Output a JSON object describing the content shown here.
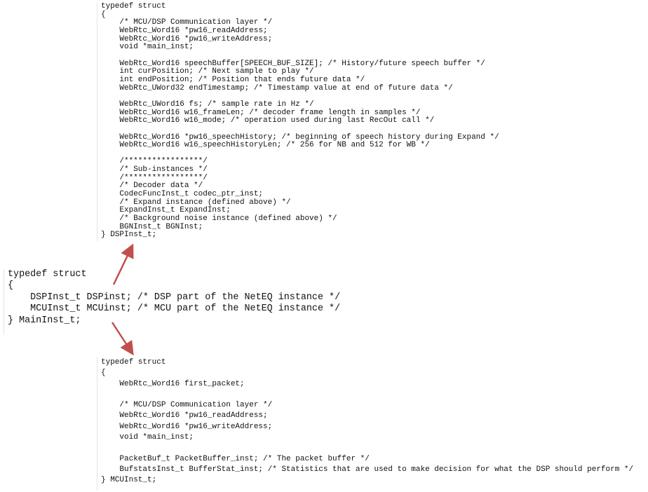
{
  "dsp_struct": {
    "lines": [
      "typedef struct",
      "{",
      "    /* MCU/DSP Communication layer */",
      "    WebRtc_Word16 *pw16_readAddress;",
      "    WebRtc_Word16 *pw16_writeAddress;",
      "    void *main_inst;",
      "",
      "    WebRtc_Word16 speechBuffer[SPEECH_BUF_SIZE]; /* History/future speech buffer */",
      "    int curPosition; /* Next sample to play */",
      "    int endPosition; /* Position that ends future data */",
      "    WebRtc_UWord32 endTimestamp; /* Timestamp value at end of future data */",
      "",
      "    WebRtc_UWord16 fs; /* sample rate in Hz */",
      "    WebRtc_Word16 w16_frameLen; /* decoder frame length in samples */",
      "    WebRtc_Word16 w16_mode; /* operation used during last RecOut call */",
      "",
      "    WebRtc_Word16 *pw16_speechHistory; /* beginning of speech history during Expand */",
      "    WebRtc_Word16 w16_speechHistoryLen; /* 256 for NB and 512 for WB */",
      "",
      "    /*****************/",
      "    /* Sub-instances */",
      "    /*****************/",
      "    /* Decoder data */",
      "    CodecFuncInst_t codec_ptr_inst;",
      "    /* Expand instance (defined above) */",
      "    ExpandInst_t ExpandInst;",
      "    /* Background noise instance (defined above) */",
      "    BGNInst_t BGNInst;",
      "} DSPInst_t;"
    ]
  },
  "main_struct": {
    "lines": [
      "typedef struct",
      "{",
      "    DSPInst_t DSPinst; /* DSP part of the NetEQ instance */",
      "    MCUInst_t MCUinst; /* MCU part of the NetEQ instance */",
      "} MainInst_t;"
    ]
  },
  "mcu_struct": {
    "lines": [
      "typedef struct",
      "{",
      "    WebRtc_Word16 first_packet;",
      "",
      "    /* MCU/DSP Communication layer */",
      "    WebRtc_Word16 *pw16_readAddress;",
      "    WebRtc_Word16 *pw16_writeAddress;",
      "    void *main_inst;",
      "",
      "    PacketBuf_t PacketBuffer_inst; /* The packet buffer */",
      "    BufstatsInst_t BufferStat_inst; /* Statistics that are used to make decision for what the DSP should perform */",
      "} MCUInst_t;"
    ]
  },
  "colors": {
    "arrow": "#c0504d",
    "text": "#111111"
  }
}
